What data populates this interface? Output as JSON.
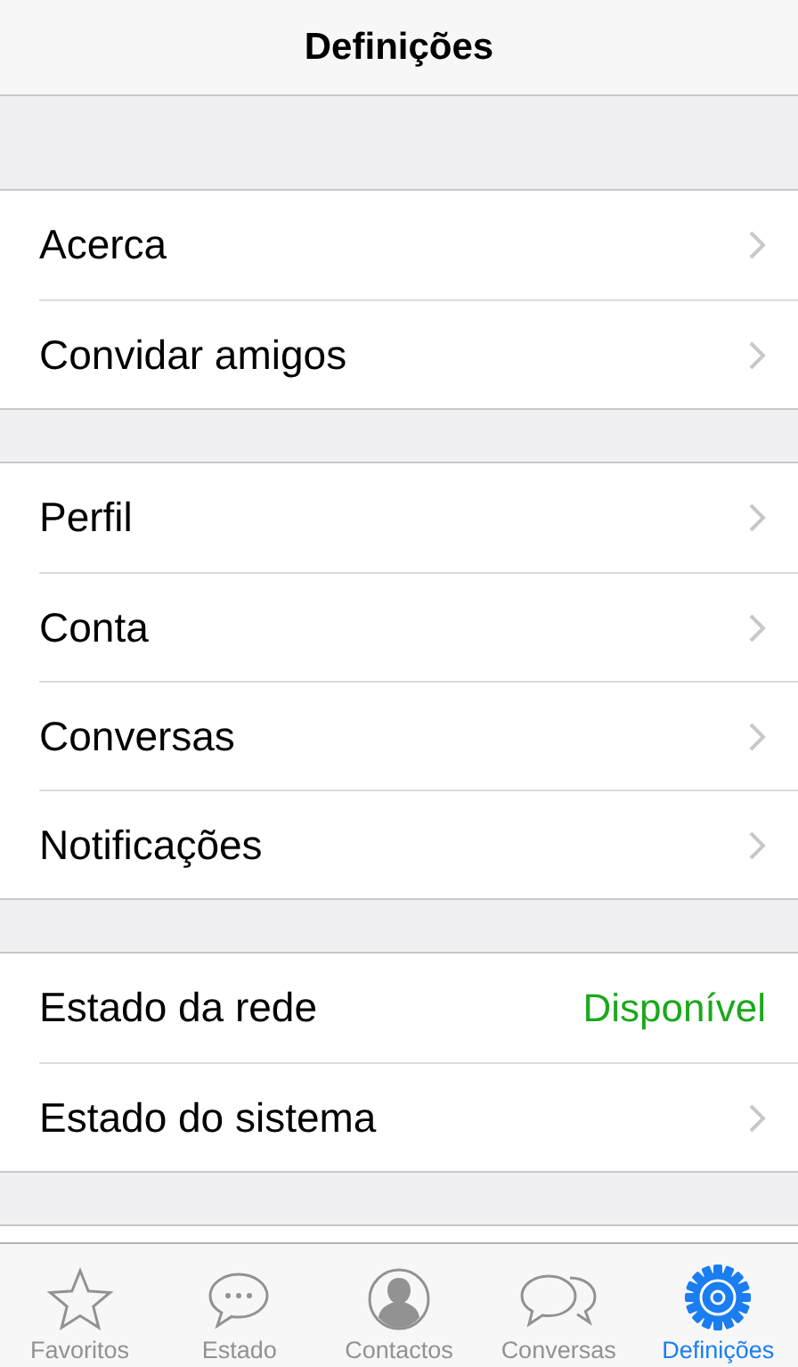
{
  "title": "Definições",
  "groups": [
    {
      "rows": [
        {
          "kind": "link",
          "label": "Acerca"
        },
        {
          "kind": "link",
          "label": "Convidar amigos"
        }
      ]
    },
    {
      "rows": [
        {
          "kind": "link",
          "label": "Perfil"
        },
        {
          "kind": "link",
          "label": "Conta"
        },
        {
          "kind": "link",
          "label": "Conversas"
        },
        {
          "kind": "link",
          "label": "Notificações"
        }
      ]
    },
    {
      "rows": [
        {
          "kind": "status",
          "label": "Estado da rede",
          "value": "Disponível"
        },
        {
          "kind": "link",
          "label": "Estado do sistema"
        }
      ]
    }
  ],
  "tabs": [
    {
      "kind": "star",
      "label": "Favoritos",
      "selected": false
    },
    {
      "kind": "bubble",
      "label": "Estado",
      "selected": false
    },
    {
      "kind": "person",
      "label": "Contactos",
      "selected": false
    },
    {
      "kind": "bubbles",
      "label": "Conversas",
      "selected": false
    },
    {
      "kind": "gear",
      "label": "Definições",
      "selected": true
    }
  ]
}
